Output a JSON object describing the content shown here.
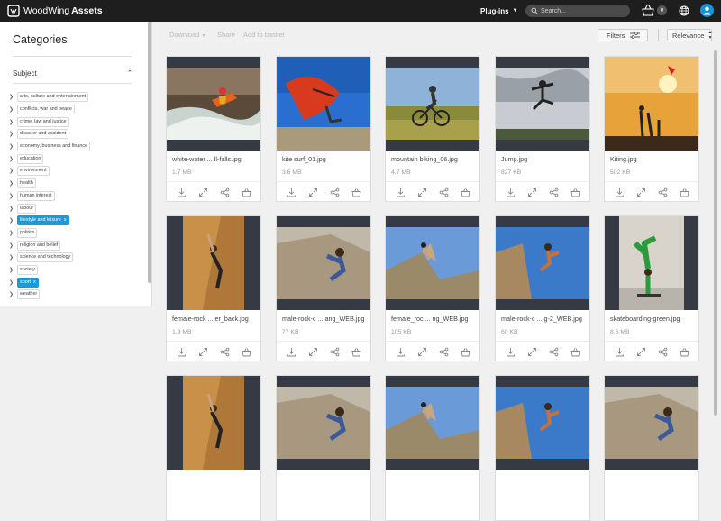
{
  "app": {
    "brand": "WoodWing",
    "product": "Assets"
  },
  "topbar": {
    "plugins_label": "Plug-ins",
    "search_placeholder": "Search...",
    "cart_count": "0"
  },
  "sidebar": {
    "title": "Categories",
    "section": "Subject",
    "tags": [
      {
        "label": "arts, culture and entertainment",
        "selected": false
      },
      {
        "label": "conflicts, war and peace",
        "selected": false
      },
      {
        "label": "crime, law and justice",
        "selected": false
      },
      {
        "label": "disaster and accident",
        "selected": false
      },
      {
        "label": "economy, business and finance",
        "selected": false
      },
      {
        "label": "education",
        "selected": false
      },
      {
        "label": "environment",
        "selected": false
      },
      {
        "label": "health",
        "selected": false
      },
      {
        "label": "human interest",
        "selected": false
      },
      {
        "label": "labour",
        "selected": false
      },
      {
        "label": "lifestyle and leisure",
        "selected": true
      },
      {
        "label": "politics",
        "selected": false
      },
      {
        "label": "religion and belief",
        "selected": false
      },
      {
        "label": "science and technology",
        "selected": false
      },
      {
        "label": "society",
        "selected": false
      },
      {
        "label": "sport",
        "selected": true
      },
      {
        "label": "weather",
        "selected": false
      }
    ]
  },
  "toolbar": {
    "download": "Download",
    "share": "Share",
    "add_to_basket": "Add to basket",
    "filters": "Filters",
    "sort": "Relevance"
  },
  "colors": {
    "accent": "#1a9ad6",
    "topbar": "#1e1e1e",
    "thumb_bg": "#353a45"
  },
  "assets": [
    {
      "name": "white-water ... ll-falls.jpg",
      "size": "1.7 MB",
      "scene": "kayak"
    },
    {
      "name": "kite surf_01.jpg",
      "size": "3.6 MB",
      "scene": "kite"
    },
    {
      "name": "mountain biking_06.jpg",
      "size": "4.7 MB",
      "scene": "bike"
    },
    {
      "name": "Jump.jpg",
      "size": "827 KB",
      "scene": "jump"
    },
    {
      "name": "Kiting.jpg",
      "size": "502 KB",
      "scene": "kiting"
    },
    {
      "name": "female-rock ... er_back.jpg",
      "size": "1.9 MB",
      "scene": "rock1"
    },
    {
      "name": "male-rock-c ... ang_WEB.jpg",
      "size": "77 KB",
      "scene": "rock2"
    },
    {
      "name": "female_roc ... ng_WEB.jpg",
      "size": "105 KB",
      "scene": "rock3"
    },
    {
      "name": "male-rock-c ... g-2_WEB.jpg",
      "size": "60 KB",
      "scene": "rock4"
    },
    {
      "name": "skateboarding-green.jpg",
      "size": "8.6 MB",
      "scene": "skate"
    },
    {
      "name": "",
      "size": "",
      "scene": "rock1"
    },
    {
      "name": "",
      "size": "",
      "scene": "rock2"
    },
    {
      "name": "",
      "size": "",
      "scene": "rock3"
    },
    {
      "name": "",
      "size": "",
      "scene": "rock4"
    },
    {
      "name": "",
      "size": "",
      "scene": "rock2"
    }
  ]
}
